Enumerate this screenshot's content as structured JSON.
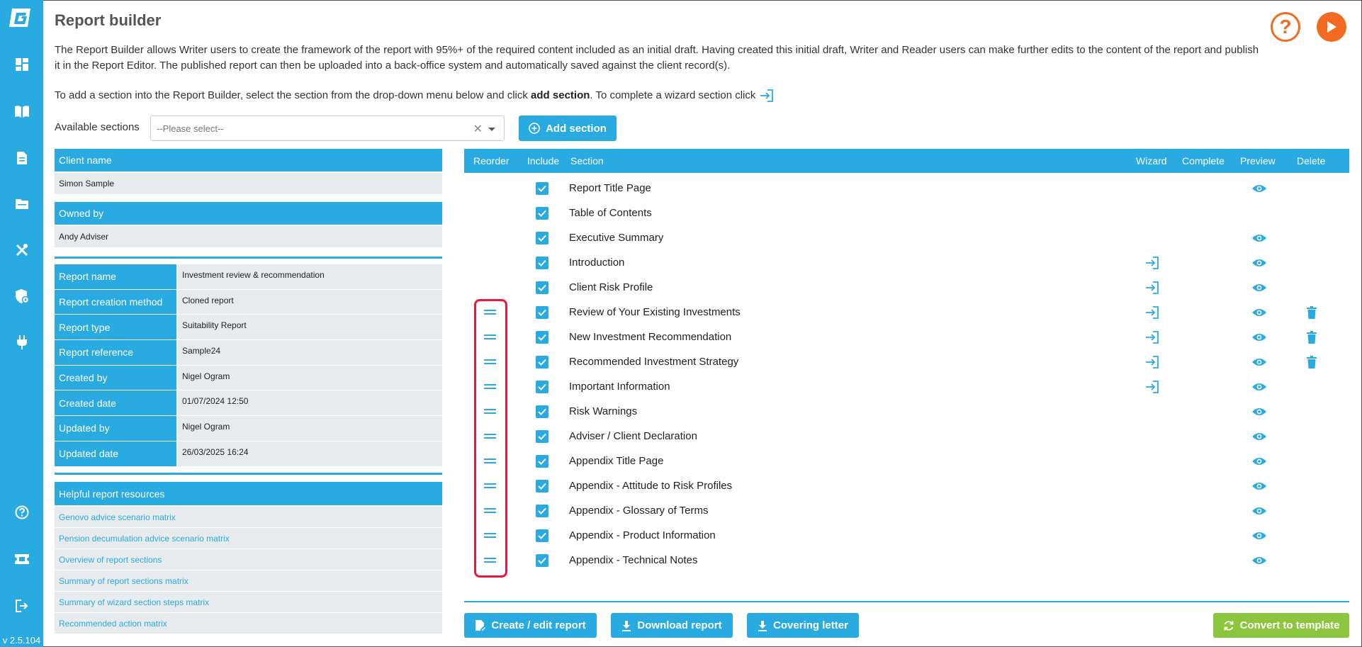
{
  "app": {
    "version": "v 2.5.104",
    "title": "Report builder"
  },
  "sidebar": {
    "items": [
      {
        "icon": "dashboard-icon"
      },
      {
        "icon": "book-icon"
      },
      {
        "icon": "document-icon"
      },
      {
        "icon": "folder-icon"
      },
      {
        "icon": "tools-icon"
      },
      {
        "icon": "shield-settings-icon"
      },
      {
        "icon": "plug-icon"
      }
    ],
    "bottom": [
      {
        "icon": "help-icon"
      },
      {
        "icon": "ticket-icon"
      },
      {
        "icon": "logout-icon"
      }
    ]
  },
  "intro": {
    "paragraph": "The Report Builder allows Writer users to create the framework of the report with 95%+ of the required content included as an initial draft. Having created this initial draft, Writer and Reader users can make further edits to the content of the report and publish it in the Report Editor. The published report can then be uploaded into a back-office system and automatically saved against the client record(s).",
    "line2_pre": "To add a section into the Report Builder, select the section from the drop-down menu below and click",
    "line2_bold": "add section",
    "line2_post": ". To complete a wizard section click"
  },
  "toolbar": {
    "available_label": "Available sections",
    "select_placeholder": "--Please select--",
    "add_section": "Add section"
  },
  "client": {
    "client_name_label": "Client name",
    "client_name": "Simon Sample",
    "owned_by_label": "Owned by",
    "owned_by": "Andy Adviser"
  },
  "report_details": [
    {
      "label": "Report name",
      "value": "Investment review & recommendation"
    },
    {
      "label": "Report creation method",
      "value": "Cloned report"
    },
    {
      "label": "Report type",
      "value": "Suitability Report"
    },
    {
      "label": "Report reference",
      "value": "Sample24"
    },
    {
      "label": "Created by",
      "value": "Nigel Ogram"
    },
    {
      "label": "Created date",
      "value": "01/07/2024 12:50"
    },
    {
      "label": "Updated by",
      "value": "Nigel Ogram"
    },
    {
      "label": "Updated date",
      "value": "26/03/2025 16:24"
    }
  ],
  "resources": {
    "title": "Helpful report resources",
    "links": [
      "Genovo advice scenario matrix",
      "Pension decumulation advice scenario matrix",
      "Overview of report sections",
      "Summary of report sections matrix",
      "Summary of wizard section steps matrix",
      "Recommended action matrix"
    ]
  },
  "table": {
    "headers": {
      "reorder": "Reorder",
      "include": "Include",
      "section": "Section",
      "wizard": "Wizard",
      "complete": "Complete",
      "preview": "Preview",
      "delete": "Delete"
    },
    "rows": [
      {
        "name": "Report Title Page",
        "reorder": false,
        "included": true,
        "wizard": false,
        "preview": true,
        "delete": false
      },
      {
        "name": "Table of Contents",
        "reorder": false,
        "included": true,
        "wizard": false,
        "preview": false,
        "delete": false
      },
      {
        "name": "Executive Summary",
        "reorder": false,
        "included": true,
        "wizard": false,
        "preview": true,
        "delete": false
      },
      {
        "name": "Introduction",
        "reorder": false,
        "included": true,
        "wizard": true,
        "preview": true,
        "delete": false
      },
      {
        "name": "Client Risk Profile",
        "reorder": false,
        "included": true,
        "wizard": true,
        "preview": true,
        "delete": false
      },
      {
        "name": "Review of Your Existing Investments",
        "reorder": true,
        "included": true,
        "wizard": true,
        "preview": true,
        "delete": true
      },
      {
        "name": "New Investment Recommendation",
        "reorder": true,
        "included": true,
        "wizard": true,
        "preview": true,
        "delete": true
      },
      {
        "name": "Recommended Investment Strategy",
        "reorder": true,
        "included": true,
        "wizard": true,
        "preview": true,
        "delete": true
      },
      {
        "name": "Important Information",
        "reorder": true,
        "included": true,
        "wizard": true,
        "preview": true,
        "delete": false
      },
      {
        "name": "Risk Warnings",
        "reorder": true,
        "included": true,
        "wizard": false,
        "preview": true,
        "delete": false
      },
      {
        "name": "Adviser / Client Declaration",
        "reorder": true,
        "included": true,
        "wizard": false,
        "preview": true,
        "delete": false
      },
      {
        "name": "Appendix Title Page",
        "reorder": true,
        "included": true,
        "wizard": false,
        "preview": true,
        "delete": false
      },
      {
        "name": "Appendix - Attitude to Risk Profiles",
        "reorder": true,
        "included": true,
        "wizard": false,
        "preview": true,
        "delete": false
      },
      {
        "name": "Appendix - Glossary of Terms",
        "reorder": true,
        "included": true,
        "wizard": false,
        "preview": true,
        "delete": false
      },
      {
        "name": "Appendix - Product Information",
        "reorder": true,
        "included": true,
        "wizard": false,
        "preview": true,
        "delete": false
      },
      {
        "name": "Appendix - Technical Notes",
        "reorder": true,
        "included": true,
        "wizard": false,
        "preview": true,
        "delete": false
      }
    ]
  },
  "actions": {
    "create_edit": "Create / edit report",
    "download": "Download report",
    "covering_letter": "Covering letter",
    "convert": "Convert to template"
  },
  "colors": {
    "primary": "#29abe2",
    "accent_orange": "#f26b21",
    "green": "#8cc63f",
    "highlight": "#e8193c"
  }
}
